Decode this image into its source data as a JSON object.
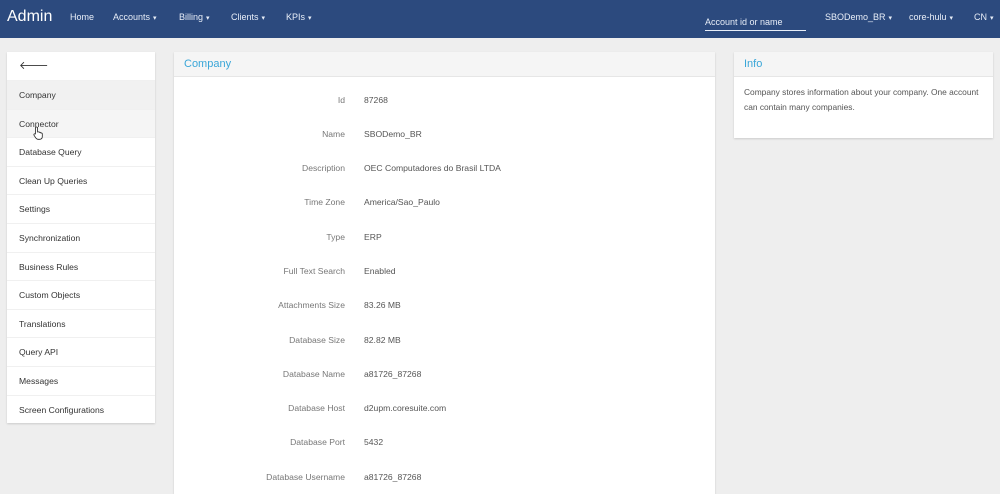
{
  "navbar": {
    "brand": "Admin",
    "items": [
      {
        "label": "Home",
        "caret": false
      },
      {
        "label": "Accounts",
        "caret": true
      },
      {
        "label": "Billing",
        "caret": true
      },
      {
        "label": "Clients",
        "caret": true
      },
      {
        "label": "KPIs",
        "caret": true
      }
    ],
    "search_placeholder": "Account id or name",
    "right_items": [
      {
        "label": "SBODemo_BR"
      },
      {
        "label": "core-hulu"
      },
      {
        "label": "CN"
      }
    ],
    "caret_glyph": "▾"
  },
  "sidemenu": {
    "back_glyph": "🡐",
    "items": [
      "Company",
      "Connector",
      "Database Query",
      "Clean Up Queries",
      "Settings",
      "Synchronization",
      "Business Rules",
      "Custom Objects",
      "Translations",
      "Query API",
      "Messages",
      "Screen Configurations"
    ]
  },
  "company": {
    "title": "Company",
    "fields": [
      {
        "label": "Id",
        "value": "87268"
      },
      {
        "label": "Name",
        "value": "SBODemo_BR"
      },
      {
        "label": "Description",
        "value": "OEC Computadores do Brasil LTDA"
      },
      {
        "label": "Time Zone",
        "value": "America/Sao_Paulo"
      },
      {
        "label": "Type",
        "value": "ERP"
      },
      {
        "label": "Full Text Search",
        "value": "Enabled"
      },
      {
        "label": "Attachments Size",
        "value": "83.26 MB"
      },
      {
        "label": "Database Size",
        "value": "82.82 MB"
      },
      {
        "label": "Database Name",
        "value": "a81726_87268"
      },
      {
        "label": "Database Host",
        "value": "d2upm.coresuite.com"
      },
      {
        "label": "Database Port",
        "value": "5432"
      },
      {
        "label": "Database Username",
        "value": "a81726_87268"
      }
    ]
  },
  "info": {
    "title": "Info",
    "text": "Company stores information about your company. One account can contain many companies."
  },
  "colors": {
    "navbar": "#2c4a7e",
    "accent": "#3aa6d8"
  }
}
